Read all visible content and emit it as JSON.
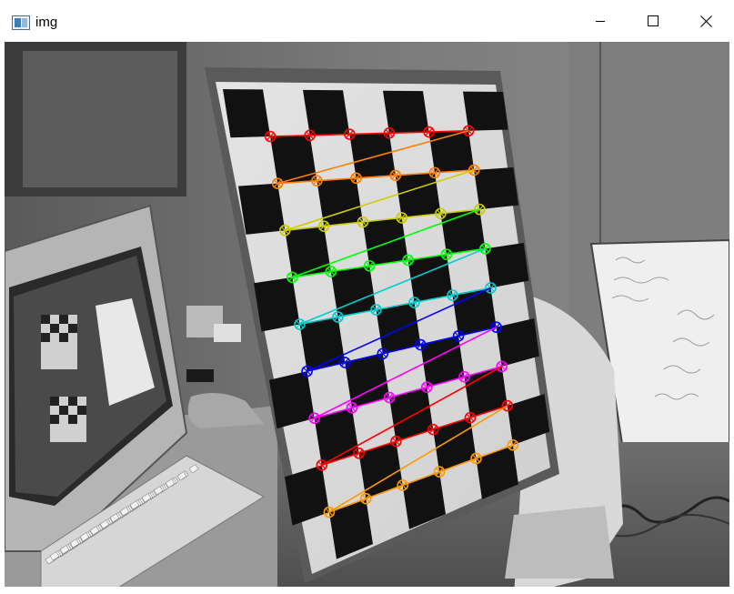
{
  "window": {
    "title": "img",
    "icons": {
      "app": "opencv-image-window-icon",
      "minimize": "minimize-icon",
      "maximize": "maximize-icon",
      "close": "close-icon"
    }
  },
  "image": {
    "description_tag": "chessboard-calibration-corners",
    "grid_rows": 9,
    "grid_cols": 6,
    "row_colors": [
      "#ff0000",
      "#ff7f00",
      "#cccc00",
      "#00ff00",
      "#00cccc",
      "#0000ff",
      "#ff00ff",
      "#ff0000",
      "#ff9900"
    ]
  }
}
